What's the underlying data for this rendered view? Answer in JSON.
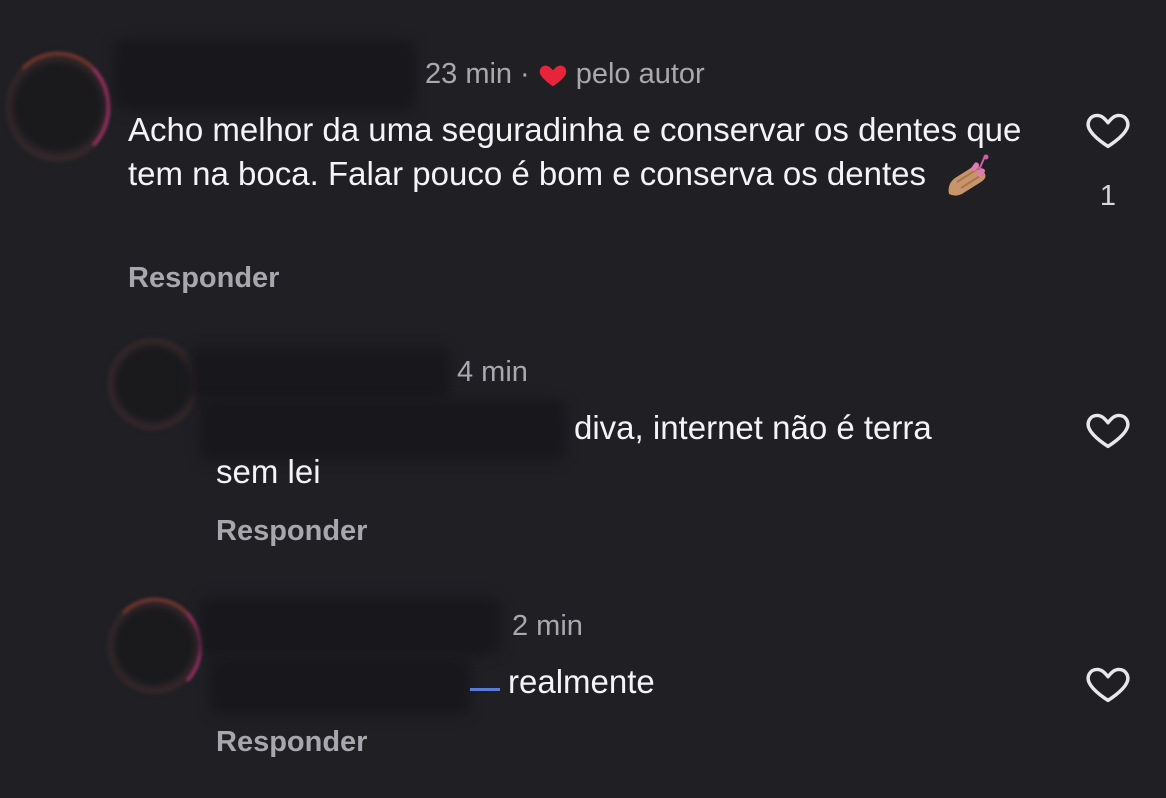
{
  "comments": [
    {
      "time": "23 min",
      "separator": "·",
      "author_like_label": "pelo autor",
      "text": "Acho melhor da uma seguradinha e conservar os dentes que tem na boca. Falar pouco é bom e conserva os dentes",
      "emoji": "nail-polish-icon",
      "reply_label": "Responder",
      "like_count": "1"
    },
    {
      "time": "4 min",
      "text_inline": "diva, internet não é terra",
      "text_wrap": "sem lei",
      "reply_label": "Responder"
    },
    {
      "time": "2 min",
      "text": "realmente",
      "reply_label": "Responder"
    }
  ],
  "colors": {
    "background": "#1f1f24",
    "text_primary": "#f4f4f6",
    "text_secondary": "#a8a8ae",
    "author_heart": "#e8243a",
    "mention_underline": "#5a7bd6"
  }
}
